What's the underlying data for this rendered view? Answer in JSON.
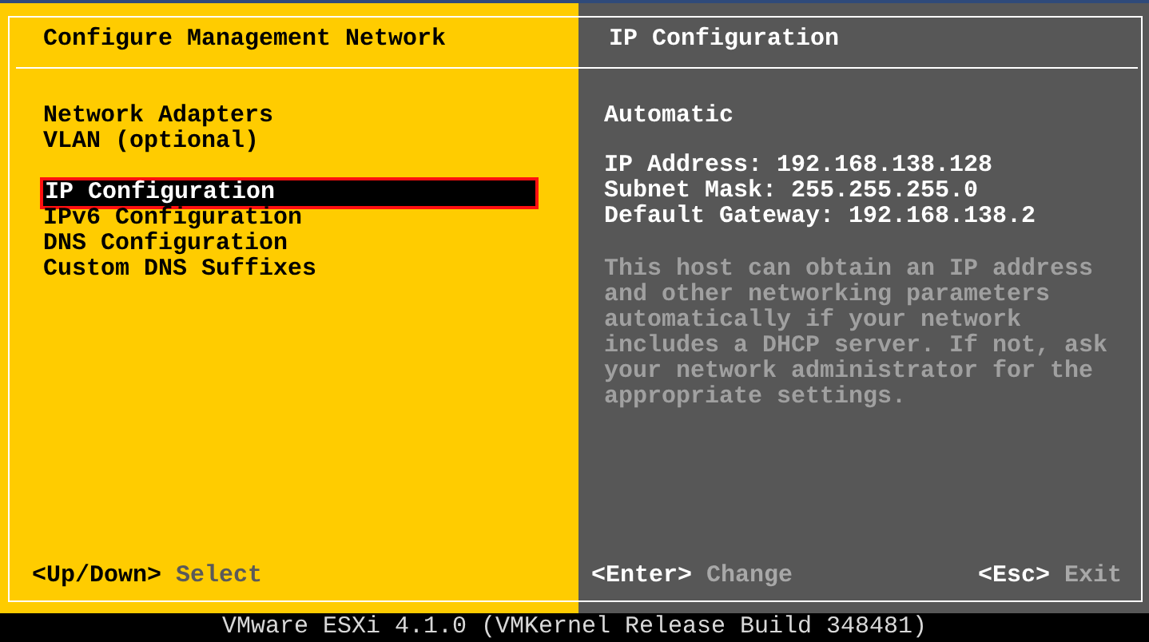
{
  "left_panel": {
    "title": "Configure Management Network",
    "menu_groups": [
      [
        {
          "label": "Network Adapters",
          "selected": false
        },
        {
          "label": "VLAN (optional)",
          "selected": false
        }
      ],
      [
        {
          "label": "IP Configuration",
          "selected": true
        },
        {
          "label": "IPv6 Configuration",
          "selected": false
        },
        {
          "label": "DNS Configuration",
          "selected": false
        },
        {
          "label": "Custom DNS Suffixes",
          "selected": false
        }
      ]
    ],
    "hints": [
      {
        "key": "<Up/Down>",
        "action": "Select"
      }
    ]
  },
  "right_panel": {
    "title": "IP Configuration",
    "mode": "Automatic",
    "details": [
      "IP Address: 192.168.138.128",
      "Subnet Mask: 255.255.255.0",
      "Default Gateway: 192.168.138.2"
    ],
    "description": "This host can obtain an IP address and other networking parameters automatically if your network includes a DHCP server. If not, ask your network administrator for the appropriate settings.",
    "hints": [
      {
        "key": "<Enter>",
        "action": "Change"
      },
      {
        "key": "<Esc>",
        "action": "Exit"
      }
    ]
  },
  "status_bar": "VMware ESXi 4.1.0 (VMKernel Release Build 348481)"
}
